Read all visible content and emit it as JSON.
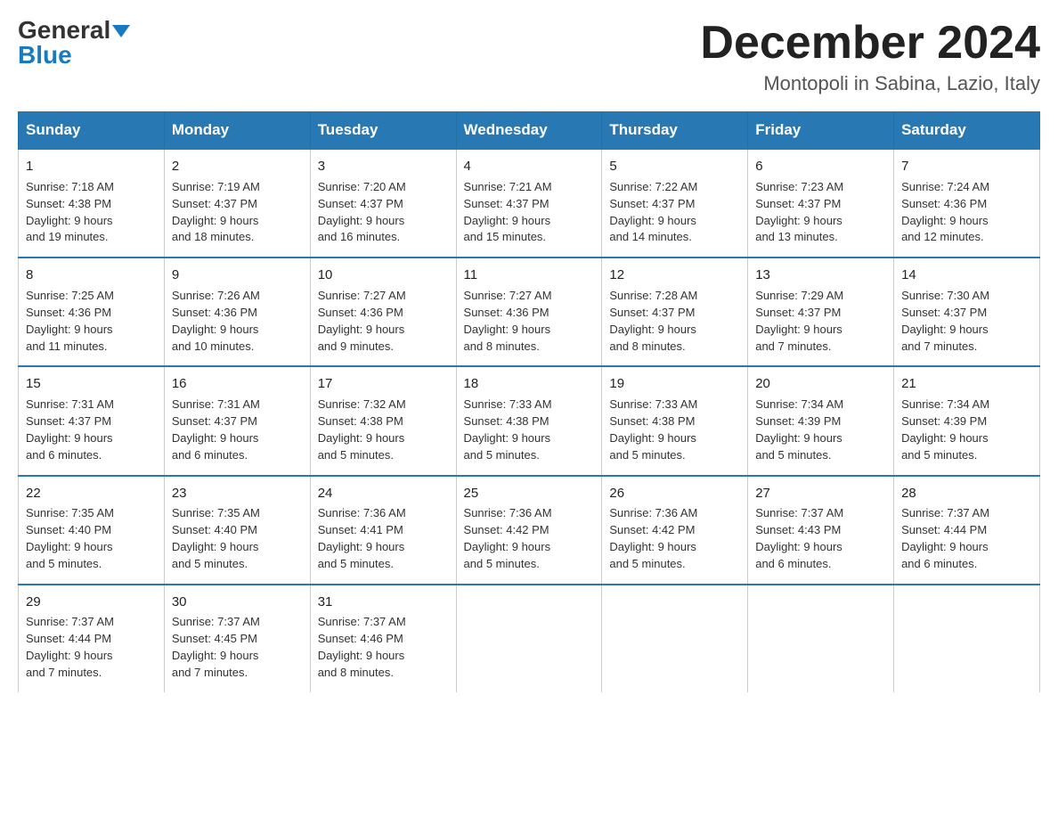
{
  "header": {
    "logo_general": "General",
    "logo_blue": "Blue",
    "month_title": "December 2024",
    "location": "Montopoli in Sabina, Lazio, Italy"
  },
  "weekdays": [
    "Sunday",
    "Monday",
    "Tuesday",
    "Wednesday",
    "Thursday",
    "Friday",
    "Saturday"
  ],
  "weeks": [
    [
      {
        "day": "1",
        "sunrise": "7:18 AM",
        "sunset": "4:38 PM",
        "daylight": "9 hours and 19 minutes."
      },
      {
        "day": "2",
        "sunrise": "7:19 AM",
        "sunset": "4:37 PM",
        "daylight": "9 hours and 18 minutes."
      },
      {
        "day": "3",
        "sunrise": "7:20 AM",
        "sunset": "4:37 PM",
        "daylight": "9 hours and 16 minutes."
      },
      {
        "day": "4",
        "sunrise": "7:21 AM",
        "sunset": "4:37 PM",
        "daylight": "9 hours and 15 minutes."
      },
      {
        "day": "5",
        "sunrise": "7:22 AM",
        "sunset": "4:37 PM",
        "daylight": "9 hours and 14 minutes."
      },
      {
        "day": "6",
        "sunrise": "7:23 AM",
        "sunset": "4:37 PM",
        "daylight": "9 hours and 13 minutes."
      },
      {
        "day": "7",
        "sunrise": "7:24 AM",
        "sunset": "4:36 PM",
        "daylight": "9 hours and 12 minutes."
      }
    ],
    [
      {
        "day": "8",
        "sunrise": "7:25 AM",
        "sunset": "4:36 PM",
        "daylight": "9 hours and 11 minutes."
      },
      {
        "day": "9",
        "sunrise": "7:26 AM",
        "sunset": "4:36 PM",
        "daylight": "9 hours and 10 minutes."
      },
      {
        "day": "10",
        "sunrise": "7:27 AM",
        "sunset": "4:36 PM",
        "daylight": "9 hours and 9 minutes."
      },
      {
        "day": "11",
        "sunrise": "7:27 AM",
        "sunset": "4:36 PM",
        "daylight": "9 hours and 8 minutes."
      },
      {
        "day": "12",
        "sunrise": "7:28 AM",
        "sunset": "4:37 PM",
        "daylight": "9 hours and 8 minutes."
      },
      {
        "day": "13",
        "sunrise": "7:29 AM",
        "sunset": "4:37 PM",
        "daylight": "9 hours and 7 minutes."
      },
      {
        "day": "14",
        "sunrise": "7:30 AM",
        "sunset": "4:37 PM",
        "daylight": "9 hours and 7 minutes."
      }
    ],
    [
      {
        "day": "15",
        "sunrise": "7:31 AM",
        "sunset": "4:37 PM",
        "daylight": "9 hours and 6 minutes."
      },
      {
        "day": "16",
        "sunrise": "7:31 AM",
        "sunset": "4:37 PM",
        "daylight": "9 hours and 6 minutes."
      },
      {
        "day": "17",
        "sunrise": "7:32 AM",
        "sunset": "4:38 PM",
        "daylight": "9 hours and 5 minutes."
      },
      {
        "day": "18",
        "sunrise": "7:33 AM",
        "sunset": "4:38 PM",
        "daylight": "9 hours and 5 minutes."
      },
      {
        "day": "19",
        "sunrise": "7:33 AM",
        "sunset": "4:38 PM",
        "daylight": "9 hours and 5 minutes."
      },
      {
        "day": "20",
        "sunrise": "7:34 AM",
        "sunset": "4:39 PM",
        "daylight": "9 hours and 5 minutes."
      },
      {
        "day": "21",
        "sunrise": "7:34 AM",
        "sunset": "4:39 PM",
        "daylight": "9 hours and 5 minutes."
      }
    ],
    [
      {
        "day": "22",
        "sunrise": "7:35 AM",
        "sunset": "4:40 PM",
        "daylight": "9 hours and 5 minutes."
      },
      {
        "day": "23",
        "sunrise": "7:35 AM",
        "sunset": "4:40 PM",
        "daylight": "9 hours and 5 minutes."
      },
      {
        "day": "24",
        "sunrise": "7:36 AM",
        "sunset": "4:41 PM",
        "daylight": "9 hours and 5 minutes."
      },
      {
        "day": "25",
        "sunrise": "7:36 AM",
        "sunset": "4:42 PM",
        "daylight": "9 hours and 5 minutes."
      },
      {
        "day": "26",
        "sunrise": "7:36 AM",
        "sunset": "4:42 PM",
        "daylight": "9 hours and 5 minutes."
      },
      {
        "day": "27",
        "sunrise": "7:37 AM",
        "sunset": "4:43 PM",
        "daylight": "9 hours and 6 minutes."
      },
      {
        "day": "28",
        "sunrise": "7:37 AM",
        "sunset": "4:44 PM",
        "daylight": "9 hours and 6 minutes."
      }
    ],
    [
      {
        "day": "29",
        "sunrise": "7:37 AM",
        "sunset": "4:44 PM",
        "daylight": "9 hours and 7 minutes."
      },
      {
        "day": "30",
        "sunrise": "7:37 AM",
        "sunset": "4:45 PM",
        "daylight": "9 hours and 7 minutes."
      },
      {
        "day": "31",
        "sunrise": "7:37 AM",
        "sunset": "4:46 PM",
        "daylight": "9 hours and 8 minutes."
      },
      null,
      null,
      null,
      null
    ]
  ],
  "labels": {
    "sunrise": "Sunrise:",
    "sunset": "Sunset:",
    "daylight": "Daylight:"
  }
}
